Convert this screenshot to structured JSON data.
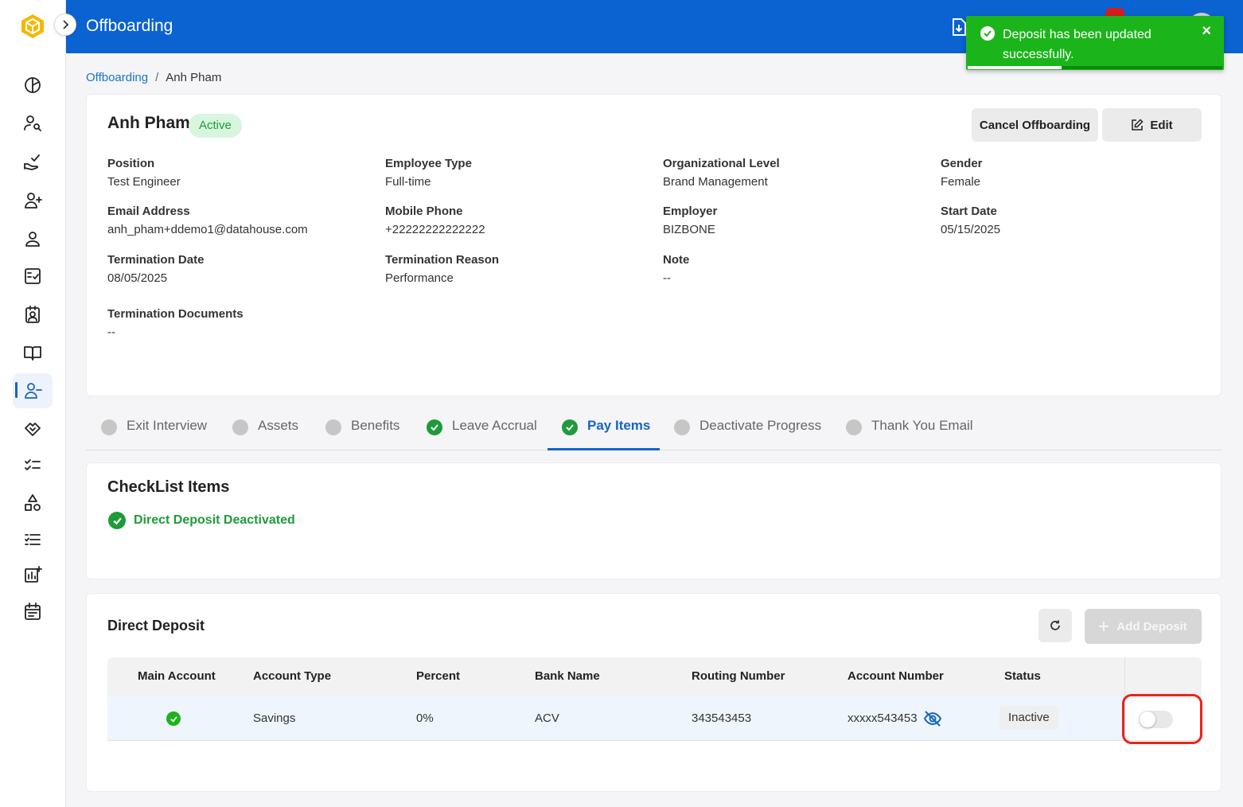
{
  "header": {
    "title": "Offboarding"
  },
  "toast": {
    "message": "Deposit has been updated successfully.",
    "close": "×",
    "progress": 0.37,
    "color": "#1bb51b"
  },
  "breadcrumb": {
    "root": "Offboarding",
    "separator": "/",
    "current": "Anh Pham"
  },
  "employee": {
    "name": "Anh Pham",
    "status": "Active",
    "buttons": {
      "cancel": "Cancel Offboarding",
      "edit": "Edit"
    },
    "fields": [
      {
        "label": "Position",
        "value": "Test Engineer"
      },
      {
        "label": "Employee Type",
        "value": "Full-time"
      },
      {
        "label": "Organizational Level",
        "value": "Brand Management"
      },
      {
        "label": "Gender",
        "value": "Female"
      },
      {
        "label": "Email Address",
        "value": "anh_pham+ddemo1@datahouse.com"
      },
      {
        "label": "Mobile Phone",
        "value": "+22222222222222"
      },
      {
        "label": "Employer",
        "value": "BIZBONE"
      },
      {
        "label": "Start Date",
        "value": "05/15/2025"
      },
      {
        "label": "Termination Date",
        "value": "08/05/2025"
      },
      {
        "label": "Termination Reason",
        "value": "Performance"
      },
      {
        "label": "Note",
        "value": "--"
      },
      {
        "label": "Termination Documents",
        "value": "--"
      }
    ]
  },
  "tabs": [
    {
      "label": "Exit Interview",
      "done": false
    },
    {
      "label": "Assets",
      "done": false
    },
    {
      "label": "Benefits",
      "done": false
    },
    {
      "label": "Leave Accrual",
      "done": true
    },
    {
      "label": "Pay Items",
      "done": true,
      "active": true
    },
    {
      "label": "Deactivate Progress",
      "done": false
    },
    {
      "label": "Thank You Email",
      "done": false
    }
  ],
  "checklist": {
    "title": "CheckList Items",
    "items": [
      "Direct Deposit Deactivated"
    ]
  },
  "deposit": {
    "title": "Direct Deposit",
    "add_label": "Add Deposit",
    "columns": [
      "Main Account",
      "Account Type",
      "Percent",
      "Bank Name",
      "Routing Number",
      "Account Number",
      "Status"
    ],
    "rows": [
      {
        "main": true,
        "account_type": "Savings",
        "percent": "0%",
        "bank_name": "ACV",
        "routing": "343543453",
        "account_number": "xxxxx543453",
        "status": "Inactive",
        "enabled": false
      }
    ]
  },
  "colors": {
    "brand_blue": "#0b62d1",
    "success_green": "#1e9b3a",
    "highlight": "#e8251a"
  },
  "sidebar_icons": [
    "dashboard-icon",
    "user-search-icon",
    "hand-check-icon",
    "user-plus-icon",
    "user-icon",
    "checklist-box-icon",
    "id-badge-icon",
    "book-icon",
    "user-minus-icon",
    "handshake-icon",
    "list-check-icon",
    "shapes-icon",
    "task-list-icon",
    "chart-add-icon",
    "calendar-icon"
  ]
}
